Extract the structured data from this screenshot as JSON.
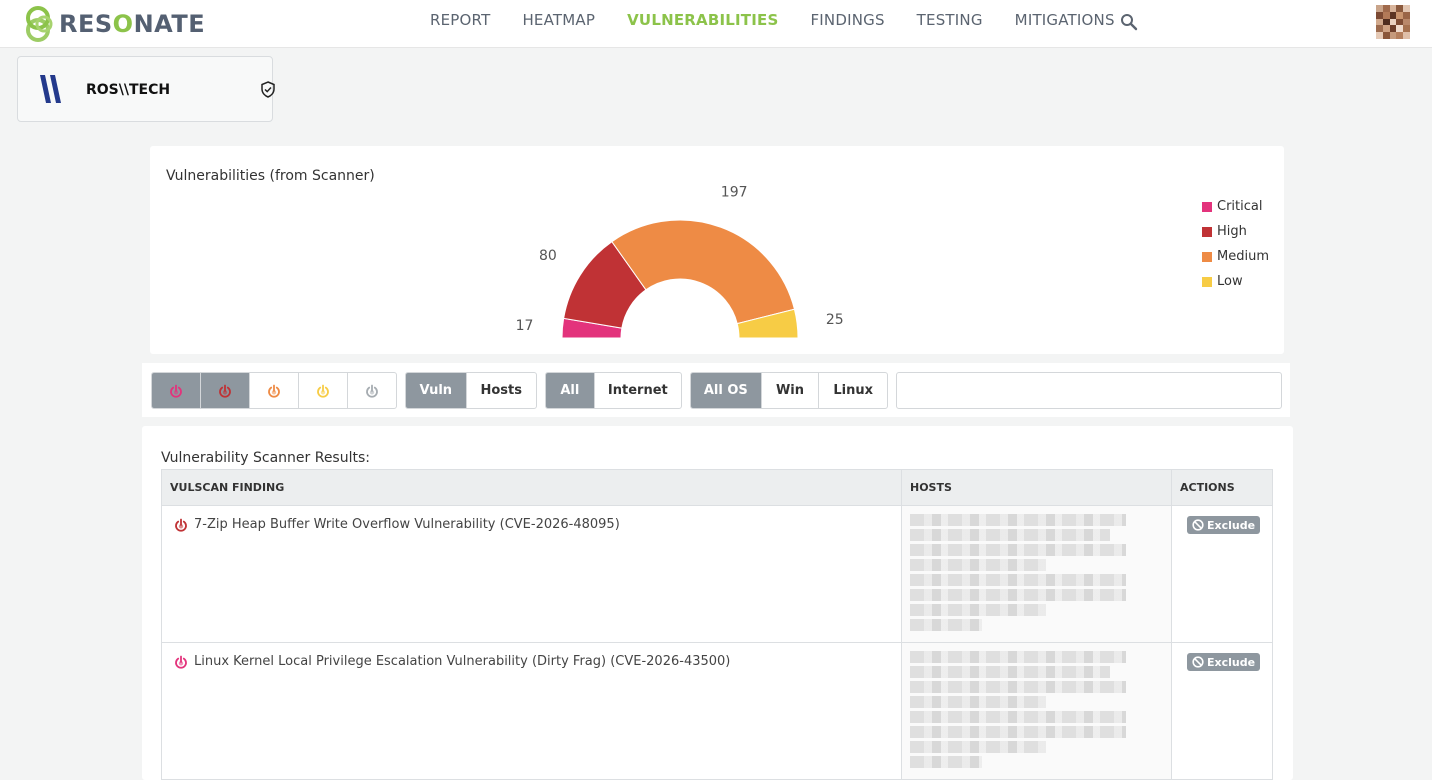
{
  "brand": {
    "name_prefix": "RES",
    "name_o": "O",
    "name_suffix": "NATE",
    "colors": {
      "green": "#8cc34a",
      "slate": "#546072"
    }
  },
  "nav": {
    "items": [
      {
        "label": "REPORT",
        "active": false
      },
      {
        "label": "HEATMAP",
        "active": false
      },
      {
        "label": "VULNERABILITIES",
        "active": true
      },
      {
        "label": "FINDINGS",
        "active": false
      },
      {
        "label": "TESTING",
        "active": false
      },
      {
        "label": "MITIGATIONS",
        "active": false
      }
    ],
    "search_icon": "search-icon",
    "avatar_icon": "user-avatar"
  },
  "org": {
    "name": "ROS\\\\TECH",
    "icon": "shield-check-icon"
  },
  "chart_data": {
    "type": "pie",
    "variant": "half-donut",
    "title": "Vulnerabilities (from Scanner)",
    "categories": [
      "Critical",
      "High",
      "Medium",
      "Low"
    ],
    "values": [
      17,
      80,
      197,
      25
    ],
    "colors": [
      "#e3337c",
      "#c03235",
      "#ee8b45",
      "#f7cc45"
    ],
    "legend_position": "top-right"
  },
  "filters": {
    "severity_icons": [
      "critical-power-icon",
      "high-power-icon",
      "medium-power-icon",
      "low-power-icon",
      "info-power-icon"
    ],
    "severity_colors": [
      "#e3337c",
      "#c03235",
      "#ee8b45",
      "#f7cc45",
      "#a6acb1"
    ],
    "severity_active": [
      true,
      true,
      false,
      false,
      false
    ],
    "view": {
      "vuln": "Vuln",
      "hosts": "Hosts"
    },
    "scope": {
      "all": "All",
      "internet": "Internet"
    },
    "os": {
      "all_os": "All OS",
      "win": "Win",
      "linux": "Linux"
    },
    "search_value": ""
  },
  "results": {
    "title": "Vulnerability Scanner Results:",
    "columns": [
      "VULSCAN FINDING",
      "HOSTS",
      "ACTIONS"
    ],
    "rows": [
      {
        "finding": "7-Zip Heap Buffer Write Overflow Vulnerability (CVE-2026-48095)",
        "severity_color": "#c03235",
        "action": "Exclude"
      },
      {
        "finding": "Linux Kernel Local Privilege Escalation Vulnerability (Dirty Frag) (CVE-2026-43500)",
        "severity_color": "#e3337c",
        "action": "Exclude"
      }
    ]
  }
}
